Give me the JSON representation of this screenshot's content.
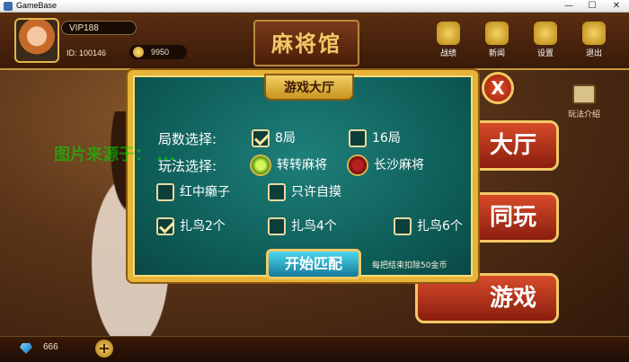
{
  "window": {
    "title": "GameBase",
    "min_glyph": "—",
    "max_glyph": "☐",
    "close_glyph": "✕"
  },
  "player": {
    "vip": "VIP188",
    "id": "ID: 100146",
    "coins": "9950",
    "gems": "666"
  },
  "logo": {
    "text": "麻将馆"
  },
  "top_menu": [
    {
      "label": "战绩",
      "icon": "trophy-icon"
    },
    {
      "label": "新闻",
      "icon": "person-icon"
    },
    {
      "label": "设置",
      "icon": "gear-icon"
    },
    {
      "label": "退出",
      "icon": "power-icon"
    }
  ],
  "side": {
    "help_label": "玩法介绍"
  },
  "background_buttons": [
    {
      "label": "大厅"
    },
    {
      "label": "同玩"
    },
    {
      "label": "游戏"
    }
  ],
  "watermark": "图片来源于：  ...",
  "dialog": {
    "title": "游戏大厅",
    "close_label": "X",
    "round_label": "局数选择:",
    "rounds": [
      {
        "label": "8局",
        "checked": true
      },
      {
        "label": "16局",
        "checked": false
      }
    ],
    "mode_label": "玩法选择:",
    "modes": [
      {
        "label": "转转麻将",
        "selected": true
      },
      {
        "label": "长沙麻将",
        "selected": false
      }
    ],
    "rules": [
      {
        "label": "红中癞子",
        "checked": false
      },
      {
        "label": "只许自摸",
        "checked": false
      }
    ],
    "birds": [
      {
        "label": "扎鸟2个",
        "checked": true
      },
      {
        "label": "扎鸟4个",
        "checked": false
      },
      {
        "label": "扎鸟6个",
        "checked": false
      }
    ],
    "start_label": "开始匹配",
    "note": "每把结束扣除50金币"
  },
  "colors": {
    "frame_gold": "#e7b338",
    "felt_teal": "#0d5a55",
    "start_cyan": "#2aa8c8"
  }
}
